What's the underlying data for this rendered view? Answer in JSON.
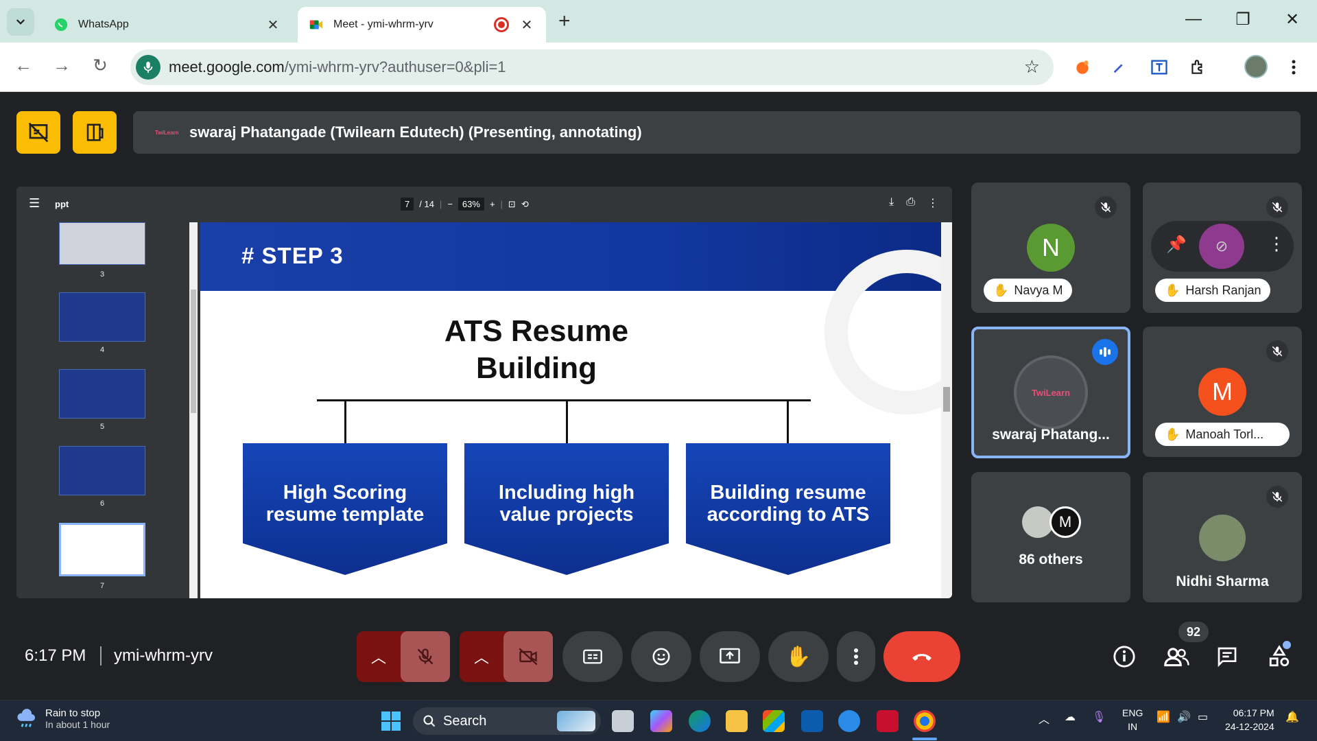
{
  "browser": {
    "tabs": [
      {
        "title": "WhatsApp",
        "icon": "whatsapp-icon",
        "active": false
      },
      {
        "title": "Meet - ymi-whrm-yrv",
        "icon": "google-meet-icon",
        "active": true,
        "recording": true
      }
    ],
    "url_host": "meet.google.com",
    "url_path": "/ymi-whrm-yrv?authuser=0&pli=1",
    "accent": "#1a7f64"
  },
  "meet": {
    "presenter_text": "swaraj Phatangade (Twilearn Edutech) (Presenting, annotating)",
    "logo_text": "TwiLearn",
    "viewer": {
      "file_name": "ppt",
      "current_page": "7",
      "total_pages": "/ 14",
      "zoom": "63%",
      "thumbnails": [
        "3",
        "4",
        "5",
        "6",
        "7"
      ]
    },
    "slide": {
      "step": "# STEP 3",
      "title_line1": "ATS Resume",
      "title_line2": "Building",
      "boxes": [
        {
          "line1": "High Scoring",
          "line2": "resume template"
        },
        {
          "line1": "Including high",
          "line2": "value projects"
        },
        {
          "line1": "Building resume",
          "line2": "according to ATS"
        }
      ]
    },
    "participants": [
      {
        "name": "Navya M",
        "initial": "N",
        "color": "#5a9a32",
        "hand_raised": true,
        "muted": true
      },
      {
        "name": "Harsh Ranjan",
        "hand_raised": true,
        "muted": true
      },
      {
        "name": "swaraj Phatang...",
        "logo_text": "TwiLearn",
        "speaking": true
      },
      {
        "name": "Manoah Torl...",
        "initial": "M",
        "color": "#f4511e",
        "hand_raised": true,
        "muted": true
      },
      {
        "name": "86 others"
      },
      {
        "name": "Nidhi Sharma",
        "muted": true
      }
    ],
    "time": "6:17 PM",
    "meeting_code": "ymi-whrm-yrv",
    "participant_count": "92"
  },
  "taskbar": {
    "weather_title": "Rain to stop",
    "weather_sub": "In about 1 hour",
    "search_label": "Search",
    "lang_line1": "ENG",
    "lang_line2": "IN",
    "clock": "06:17 PM",
    "date": "24-12-2024"
  }
}
